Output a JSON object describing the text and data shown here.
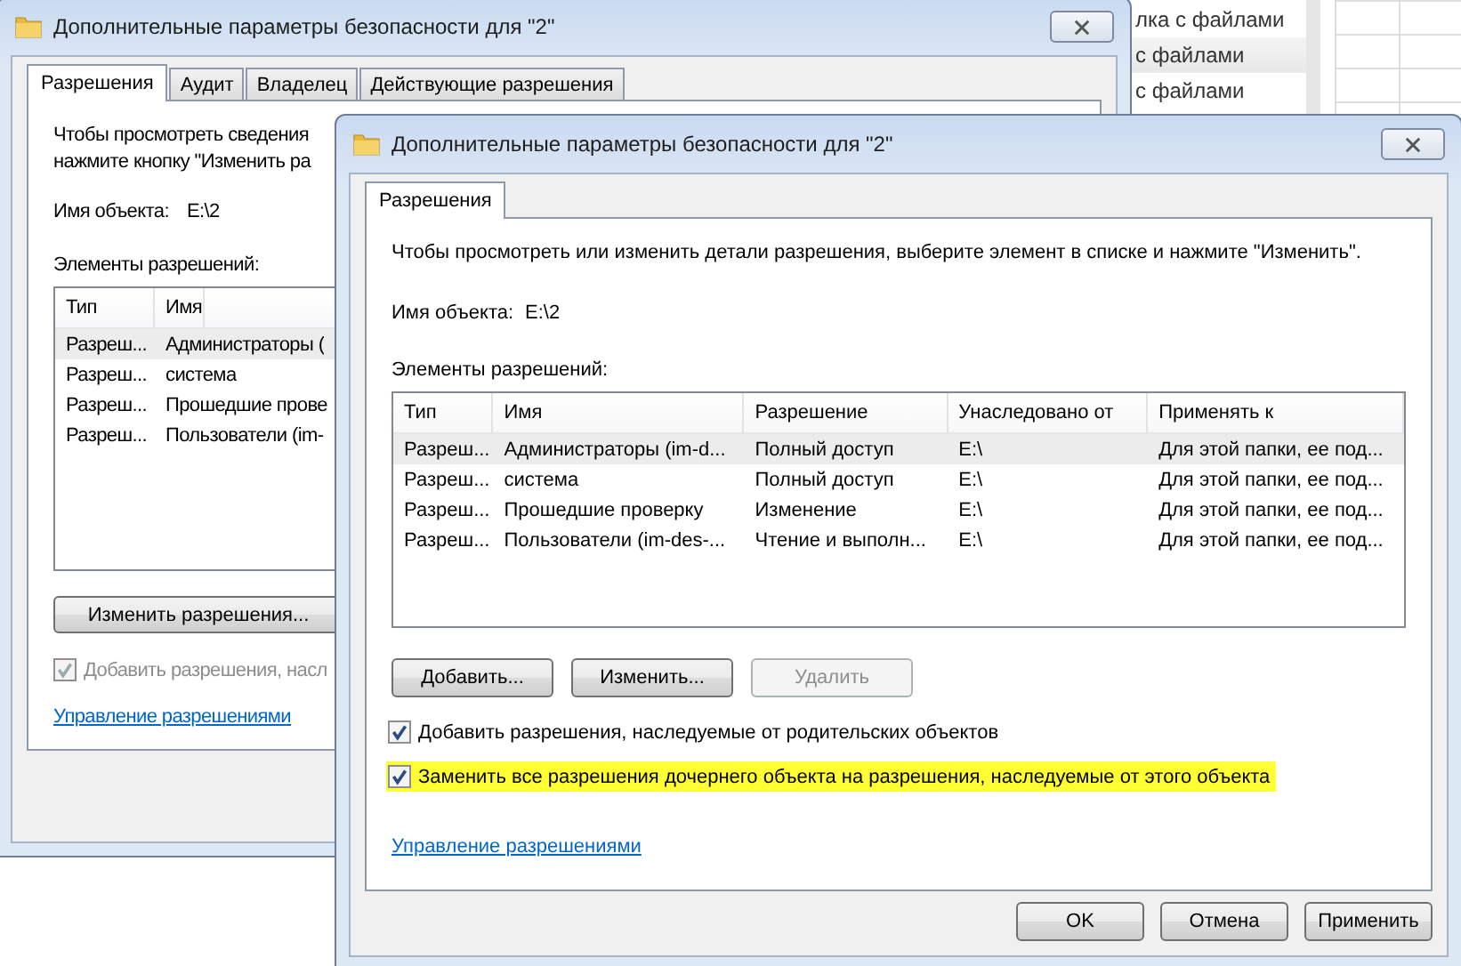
{
  "background": {
    "explorer_items": [
      {
        "label": "лка с файлами",
        "selected": false
      },
      {
        "label": "с файлами",
        "selected": true
      },
      {
        "label": "с файлами",
        "selected": false
      }
    ]
  },
  "back_window": {
    "title": "Дополнительные параметры безопасности  для \"2\"",
    "tabs": [
      {
        "label": "Разрешения",
        "selected": true
      },
      {
        "label": "Аудит",
        "selected": false
      },
      {
        "label": "Владелец",
        "selected": false
      },
      {
        "label": "Действующие разрешения",
        "selected": false
      }
    ],
    "intro": [
      "Чтобы просмотреть сведения",
      "нажмите кнопку \"Изменить ра"
    ],
    "object_label": "Имя объекта:",
    "object_value": "E:\\2",
    "list_label": "Элементы разрешений:",
    "columns": [
      "Тип",
      "Имя"
    ],
    "rows": [
      {
        "cells": [
          "Разреш...",
          "Администраторы ("
        ],
        "selected": true
      },
      {
        "cells": [
          "Разреш...",
          "система"
        ],
        "selected": false
      },
      {
        "cells": [
          "Разреш...",
          "Прошедшие прове"
        ],
        "selected": false
      },
      {
        "cells": [
          "Разреш...",
          "Пользователи (im-"
        ],
        "selected": false
      }
    ],
    "change_button": "Изменить разрешения...",
    "checkbox": {
      "label": "Добавить разрешения, насл",
      "checked": true,
      "disabled": true
    },
    "link": "Управление разрешениями"
  },
  "front_window": {
    "title": "Дополнительные параметры безопасности  для \"2\"",
    "tabs": [
      {
        "label": "Разрешения",
        "selected": true
      }
    ],
    "intro": "Чтобы просмотреть или изменить детали разрешения, выберите элемент в списке и нажмите \"Изменить\".",
    "object_label": "Имя объекта:",
    "object_value": "E:\\2",
    "list_label": "Элементы разрешений:",
    "columns": [
      "Тип",
      "Имя",
      "Разрешение",
      "Унаследовано от",
      "Применять к"
    ],
    "rows": [
      {
        "cells": [
          "Разреш...",
          "Администраторы (im-d...",
          "Полный доступ",
          "E:\\",
          "Для этой папки, ее под..."
        ],
        "selected": true
      },
      {
        "cells": [
          "Разреш...",
          "система",
          "Полный доступ",
          "E:\\",
          "Для этой папки, ее под..."
        ],
        "selected": false
      },
      {
        "cells": [
          "Разреш...",
          "Прошедшие проверку",
          "Изменение",
          "E:\\",
          "Для этой папки, ее под..."
        ],
        "selected": false
      },
      {
        "cells": [
          "Разреш...",
          "Пользователи (im-des-...",
          "Чтение и выполн...",
          "E:\\",
          "Для этой папки, ее под..."
        ],
        "selected": false
      }
    ],
    "list_buttons": [
      {
        "label": "Добавить...",
        "disabled": false
      },
      {
        "label": "Изменить...",
        "disabled": false
      },
      {
        "label": "Удалить",
        "disabled": true
      }
    ],
    "checkboxes": [
      {
        "label": "Добавить разрешения, наследуемые от родительских объектов",
        "checked": true,
        "highlighted": false
      },
      {
        "label": "Заменить все разрешения дочернего объекта на разрешения, наследуемые от этого объекта",
        "checked": true,
        "highlighted": true
      }
    ],
    "link": "Управление разрешениями",
    "buttons": [
      "OK",
      "Отмена",
      "Применить"
    ]
  }
}
